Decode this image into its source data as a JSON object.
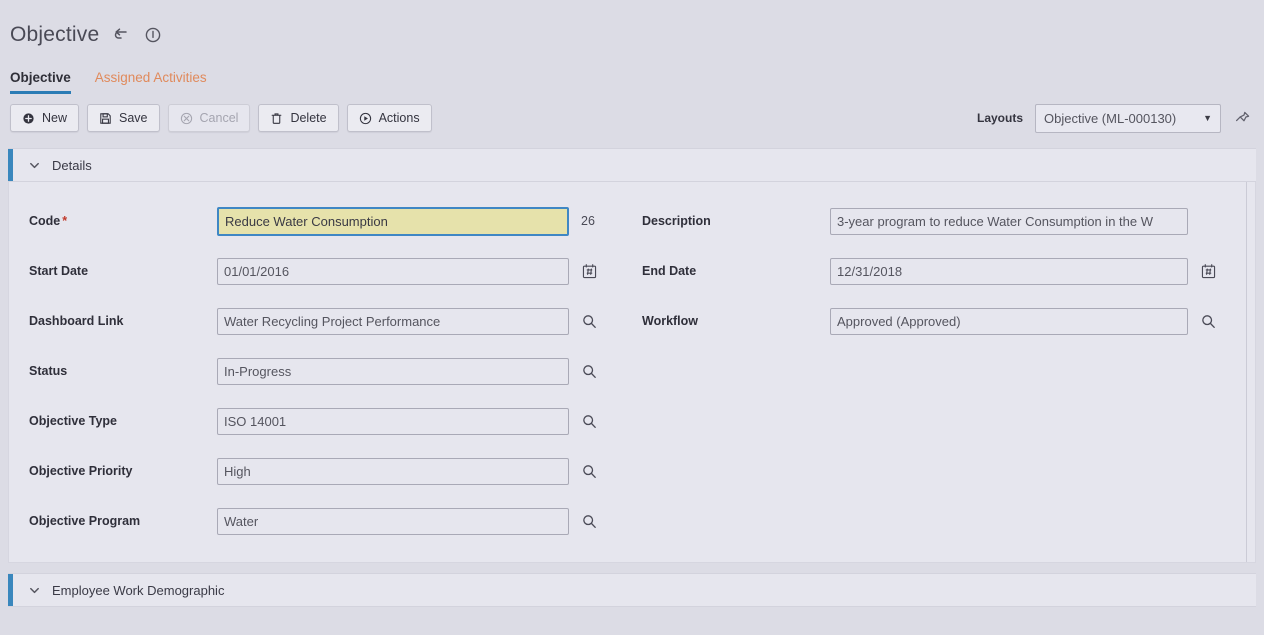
{
  "header": {
    "title": "Objective",
    "icons": [
      {
        "name": "back-arrow-icon"
      },
      {
        "name": "info-icon"
      }
    ]
  },
  "tabs": [
    {
      "label": "Objective",
      "active": true
    },
    {
      "label": "Assigned Activities",
      "active": false
    }
  ],
  "toolbar": {
    "buttons": [
      {
        "label": "New",
        "icon": "plus-circle-icon",
        "disabled": false
      },
      {
        "label": "Save",
        "icon": "save-disk-icon",
        "disabled": false
      },
      {
        "label": "Cancel",
        "icon": "cancel-circle-icon",
        "disabled": true
      },
      {
        "label": "Delete",
        "icon": "trash-icon",
        "disabled": false
      },
      {
        "label": "Actions",
        "icon": "play-circle-icon",
        "disabled": false
      }
    ],
    "layouts_label": "Layouts",
    "layouts_value": "Objective (ML-000130)",
    "pin_icon": "pushpin-icon"
  },
  "sections": [
    {
      "title": "Details",
      "expanded": true
    },
    {
      "title": "Employee Work Demographic",
      "expanded": true
    }
  ],
  "fields": {
    "left": [
      {
        "label": "Code",
        "required": true,
        "value": "Reduce Water Consumption",
        "focused": true,
        "counter": "26",
        "adornment": "none"
      },
      {
        "label": "Start Date",
        "required": false,
        "value": "01/01/2016",
        "focused": false,
        "adornment": "calendar-icon"
      },
      {
        "label": "Dashboard Link",
        "required": false,
        "value": "Water Recycling Project Performance",
        "focused": false,
        "adornment": "search-icon"
      },
      {
        "label": "Status",
        "required": false,
        "value": "In-Progress",
        "focused": false,
        "adornment": "search-icon"
      },
      {
        "label": "Objective Type",
        "required": false,
        "value": "ISO 14001",
        "focused": false,
        "adornment": "search-icon"
      },
      {
        "label": "Objective Priority",
        "required": false,
        "value": "High",
        "focused": false,
        "adornment": "search-icon"
      },
      {
        "label": "Objective Program",
        "required": false,
        "value": "Water",
        "focused": false,
        "adornment": "search-icon"
      }
    ],
    "right": [
      {
        "label": "Description",
        "required": false,
        "value": "3-year program to reduce Water Consumption in the W",
        "focused": false,
        "adornment": "none"
      },
      {
        "label": "End Date",
        "required": false,
        "value": "12/31/2018",
        "focused": false,
        "adornment": "calendar-icon"
      },
      {
        "label": "Workflow",
        "required": false,
        "value": "Approved (Approved)",
        "focused": false,
        "adornment": "search-icon"
      }
    ]
  },
  "colors": {
    "page_background": "#dcdce5",
    "panel_background": "#e6e6ee",
    "accent_blue": "#3a87bd",
    "tab_active_underline": "#2b7cb5",
    "tab_inactive_text": "#e08a5c",
    "focused_field_fill": "#e6e2ab",
    "focused_field_border": "#3f87c4",
    "required_marker": "#c0392b"
  }
}
